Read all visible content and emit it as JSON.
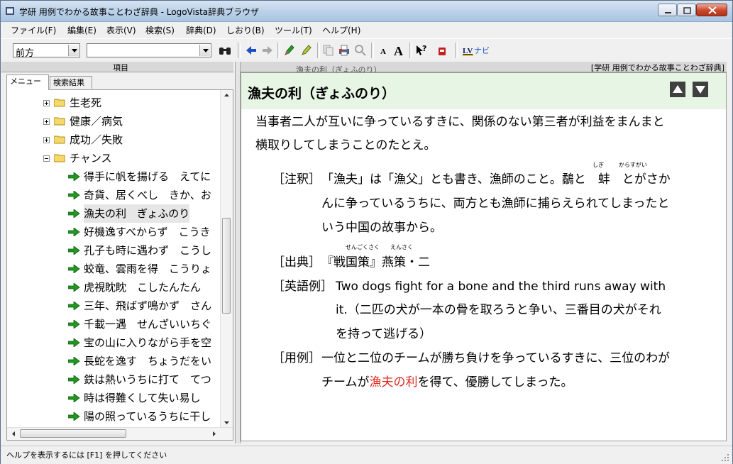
{
  "window": {
    "title": "学研 用例でわかる故事ことわざ辞典 - LogoVista辞典ブラウザ"
  },
  "menu": [
    "ファイル(F)",
    "編集(E)",
    "表示(V)",
    "検索(S)",
    "辞典(D)",
    "しおり(B)",
    "ツール(T)",
    "ヘルプ(H)"
  ],
  "toolbar": {
    "search_mode": "前方",
    "search_query": "",
    "lv_navi_label": "LVナビ"
  },
  "left_pane": {
    "header": "項目",
    "tabs": [
      "メニュー",
      "検索結果"
    ],
    "tree": [
      {
        "label": "生老死",
        "type": "folder"
      },
      {
        "label": "健康／病気",
        "type": "folder"
      },
      {
        "label": "成功／失敗",
        "type": "folder"
      },
      {
        "label": "チャンス",
        "type": "folder-open"
      },
      {
        "label": "得手に帆を揚げる　えてに",
        "type": "entry"
      },
      {
        "label": "奇貨、居くべし　きか、お",
        "type": "entry"
      },
      {
        "label": "漁夫の利　ぎょふのり",
        "type": "entry",
        "selected": true
      },
      {
        "label": "好機逸すべからず　こうき",
        "type": "entry"
      },
      {
        "label": "孔子も時に遇わず　こうし",
        "type": "entry"
      },
      {
        "label": "蛟竜、雲雨を得　こうりょ",
        "type": "entry"
      },
      {
        "label": "虎視眈眈　こしたんたん",
        "type": "entry"
      },
      {
        "label": "三年、飛ばず鳴かず　さん",
        "type": "entry"
      },
      {
        "label": "千載一遇　せんざいいちぐ",
        "type": "entry"
      },
      {
        "label": "宝の山に入りながら手を空",
        "type": "entry"
      },
      {
        "label": "長蛇を逸す　ちょうだをい",
        "type": "entry"
      },
      {
        "label": "鉄は熱いうちに打て　てつ",
        "type": "entry"
      },
      {
        "label": "時は得難くして失い易し",
        "type": "entry"
      },
      {
        "label": "陽の照っているうちに干し",
        "type": "entry"
      }
    ]
  },
  "right_pane": {
    "header_title": "漁夫の利（ぎょふのり）",
    "dictionary_name": "[学研 用例でわかる故事ことわざ辞典]",
    "entry_title": "漁夫の利（ぎょふのり）",
    "definition": [
      "当事者二人が互いに争っているすきに、関係のない第三者が利益をまんまと",
      "横取りしてしまうことのたとえ。"
    ],
    "note_label": "［注釈］",
    "note": [
      "「漁夫」は「漁父」とも書き、漁師のこと。鷸と　蚌　とがさか",
      "んに争っているうちに、両方とも漁師に捕らえられてしまったと",
      "いう中国の故事から。"
    ],
    "note_ruby": [
      "しぎ",
      "からすがい"
    ],
    "source_label": "［出典］",
    "source": "『戦国策』燕策・二",
    "source_ruby": [
      "せんごくさく",
      "えんさく"
    ],
    "english_label": "［英語例］",
    "english": [
      "Two dogs fight for a bone and the third runs away with",
      "it.（二匹の犬が一本の骨を取ろうと争い、三番目の犬がそれ",
      "を持って逃げる）"
    ],
    "usage_label": "［用例］",
    "usage_line1": "一位と二位のチームが勝ち負けを争っているすきに、三位のわが",
    "usage_pre": "チームが",
    "usage_highlight": "漁夫の利",
    "usage_post": "を得て、優勝してしまった。"
  },
  "status": {
    "text": "ヘルプを表示するには [F1] を押してください"
  }
}
